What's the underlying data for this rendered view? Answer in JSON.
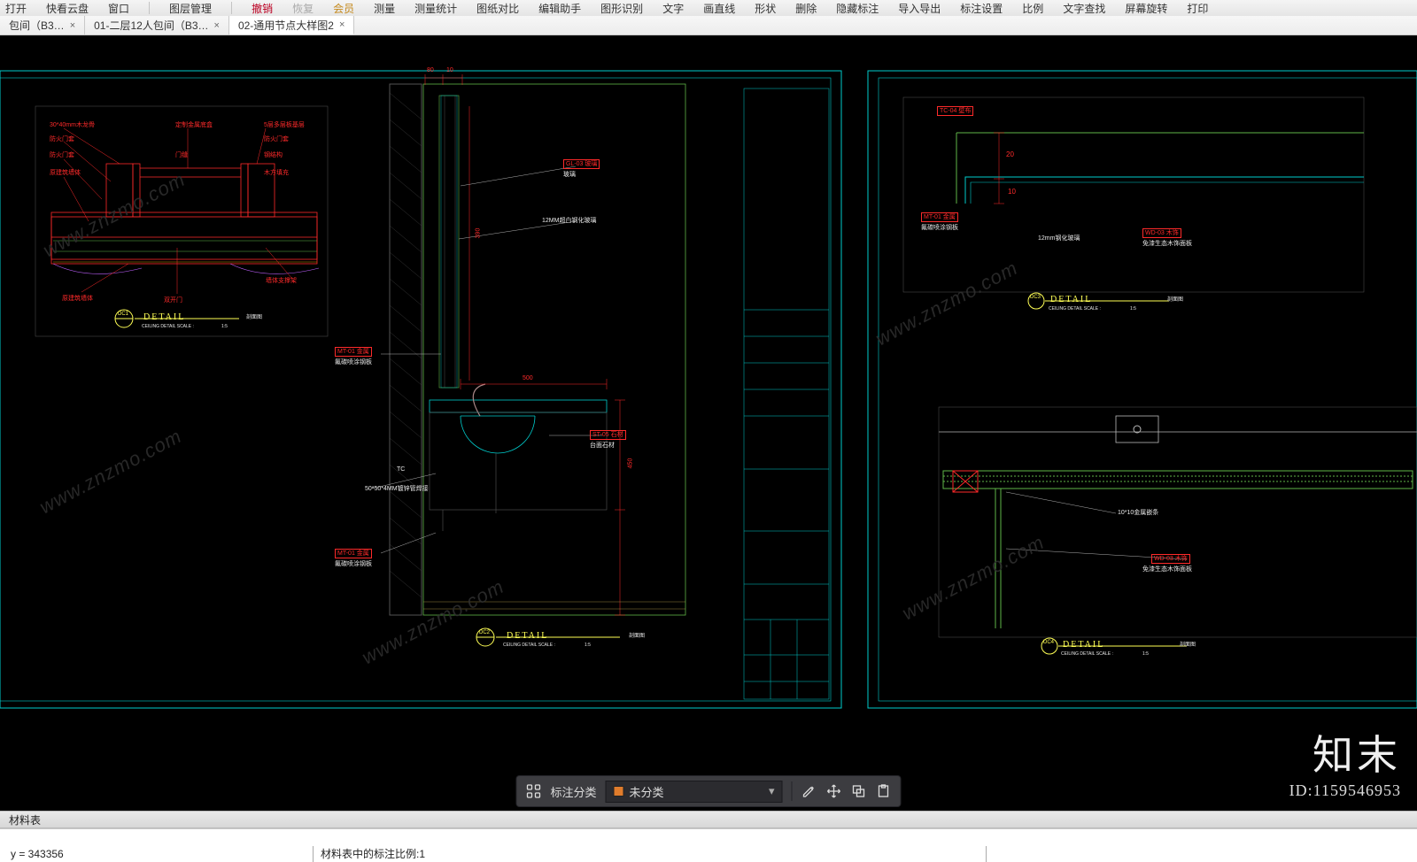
{
  "ribbon": {
    "items": [
      "打开",
      "快看云盘",
      "窗口",
      "图层管理",
      "撤销",
      "恢复",
      "会员",
      "测量",
      "测量统计",
      "图纸对比",
      "编辑助手",
      "图形识别",
      "文字",
      "画直线",
      "形状",
      "删除",
      "隐藏标注",
      "导入导出",
      "标注设置",
      "比例",
      "文字查找",
      "屏幕旋转",
      "打印"
    ],
    "gold_idx": 6,
    "red_idx": 4
  },
  "tabs": [
    {
      "label": "包间（B3…",
      "active": false
    },
    {
      "label": "01-二层12人包间（B3…",
      "active": false
    },
    {
      "label": "02-通用节点大样图2",
      "active": true
    }
  ],
  "float_toolbar": {
    "classify": "标注分类",
    "category": "未分类"
  },
  "panel": {
    "title": "材料表"
  },
  "status": {
    "coord": "y = 343356",
    "scale": "材料表中的标注比例:1"
  },
  "watermark": {
    "brand": "知末",
    "id": "ID:1159546953",
    "diag": "www.znzmo.com"
  },
  "cad": {
    "detail_title": "DETAIL",
    "detail_sub": "CEILING DETAIL SCALE :",
    "detail_scale": "1:5",
    "detail_side": "剖面图",
    "tags": {
      "gl03": "GL-03",
      "gl03_t": "玻璃",
      "mt01": "MT-01",
      "mt01_t": "金属",
      "mt01_sub": "氟碳喷涂钢板",
      "st05": "ST-05",
      "st05_t": "石材",
      "tc04": "TC-04",
      "tc04_t": "壁布",
      "wd03": "WD-03",
      "wd03_t": "木饰",
      "wd03_sub": "免漆生态木饰面板"
    },
    "dims": {
      "d80": "80",
      "d10": "10",
      "d20": "20",
      "d500": "500",
      "d450": "450",
      "d390": "390"
    },
    "notes": {
      "glass": "12MM超白钢化玻璃",
      "pipe": "50*50*4MM镀锌管焊接",
      "tc": "TC",
      "glass2": "12mm钢化玻璃",
      "note3": "10*10金属嵌条",
      "bracket": "墙体支撑架"
    },
    "left_labels": {
      "a": "30*40mm木龙骨",
      "b": "定制金属底盒",
      "c": "5层多层板基层",
      "d": "防火门套",
      "e": "门缝",
      "f": "钢结构",
      "g": "原建筑墙体",
      "h": "木方填充",
      "i": "双开门",
      "j": "墙体支撑架",
      "k": "防火门套"
    }
  }
}
